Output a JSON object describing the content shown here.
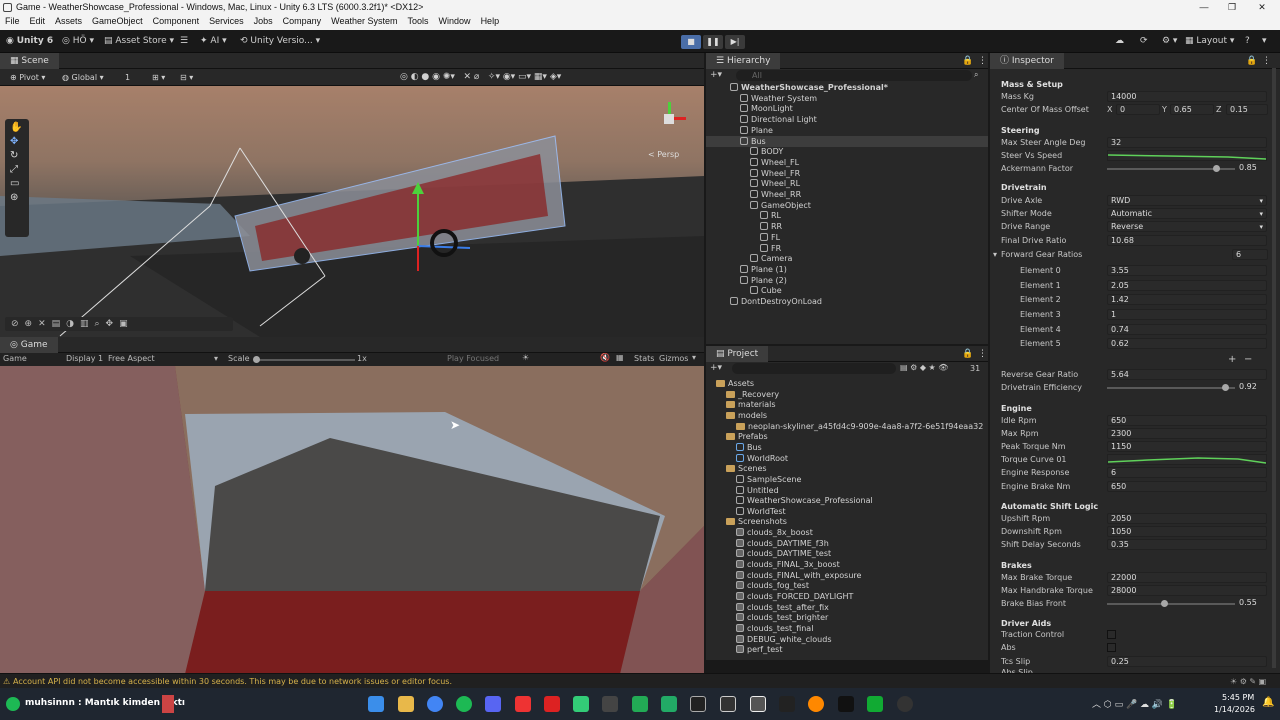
{
  "window": {
    "title": "Game - WeatherShowcase_Professional - Windows, Mac, Linux - Unity 6.3 LTS (6000.3.2f1)* <DX12>"
  },
  "menu": [
    "File",
    "Edit",
    "Assets",
    "GameObject",
    "Component",
    "Services",
    "Jobs",
    "Company",
    "Weather System",
    "Tools",
    "Window",
    "Help"
  ],
  "toolbar": {
    "unity": "Unity 6",
    "account": "HÖ",
    "asset_store": "Asset Store",
    "ai": "AI",
    "version": "Unity Versio...",
    "layout": "Layout"
  },
  "scene": {
    "tab": "Scene",
    "pivot": "Pivot",
    "global": "Global",
    "grid_snap": "1",
    "persp": "< Persp"
  },
  "game": {
    "tab": "Game",
    "game_label": "Game",
    "display": "Display 1",
    "aspect": "Free Aspect",
    "scale_label": "Scale",
    "scale_value": "1x",
    "play_focused": "Play Focused",
    "stats": "Stats",
    "gizmos": "Gizmos"
  },
  "hierarchy": {
    "tab": "Hierarchy",
    "search": "All",
    "items": [
      {
        "label": "WeatherShowcase_Professional*",
        "depth": 0,
        "bold": true
      },
      {
        "label": "Weather System",
        "depth": 1
      },
      {
        "label": "MoonLight",
        "depth": 1
      },
      {
        "label": "Directional Light",
        "depth": 1
      },
      {
        "label": "Plane",
        "depth": 1
      },
      {
        "label": "Bus",
        "depth": 1,
        "selected": true
      },
      {
        "label": "BODY",
        "depth": 2
      },
      {
        "label": "Wheel_FL",
        "depth": 2
      },
      {
        "label": "Wheel_FR",
        "depth": 2
      },
      {
        "label": "Wheel_RL",
        "depth": 2
      },
      {
        "label": "Wheel_RR",
        "depth": 2
      },
      {
        "label": "GameObject",
        "depth": 2
      },
      {
        "label": "RL",
        "depth": 3
      },
      {
        "label": "RR",
        "depth": 3
      },
      {
        "label": "FL",
        "depth": 3
      },
      {
        "label": "FR",
        "depth": 3
      },
      {
        "label": "Camera",
        "depth": 2
      },
      {
        "label": "Plane (1)",
        "depth": 1
      },
      {
        "label": "Plane (2)",
        "depth": 1
      },
      {
        "label": "Cube",
        "depth": 2
      },
      {
        "label": "DontDestroyOnLoad",
        "depth": 0
      }
    ]
  },
  "project": {
    "tab": "Project",
    "count": "31",
    "items": [
      {
        "label": "Assets",
        "depth": 0,
        "type": "folder"
      },
      {
        "label": "_Recovery",
        "depth": 1,
        "type": "folder"
      },
      {
        "label": "materials",
        "depth": 1,
        "type": "folder"
      },
      {
        "label": "models",
        "depth": 1,
        "type": "folder"
      },
      {
        "label": "neoplan-skyliner_a45fd4c9-909e-4aa8-a7f2-6e51f94eaa32",
        "depth": 2,
        "type": "folder"
      },
      {
        "label": "Prefabs",
        "depth": 1,
        "type": "folder"
      },
      {
        "label": "Bus",
        "depth": 2,
        "type": "prefab"
      },
      {
        "label": "WorldRoot",
        "depth": 2,
        "type": "prefab"
      },
      {
        "label": "Scenes",
        "depth": 1,
        "type": "folder"
      },
      {
        "label": "SampleScene",
        "depth": 2,
        "type": "scene"
      },
      {
        "label": "Untitled",
        "depth": 2,
        "type": "scene"
      },
      {
        "label": "WeatherShowcase_Professional",
        "depth": 2,
        "type": "scene"
      },
      {
        "label": "WorldTest",
        "depth": 2,
        "type": "scene"
      },
      {
        "label": "Screenshots",
        "depth": 1,
        "type": "folder"
      },
      {
        "label": "clouds_8x_boost",
        "depth": 2,
        "type": "img"
      },
      {
        "label": "clouds_DAYTIME_f3h",
        "depth": 2,
        "type": "img"
      },
      {
        "label": "clouds_DAYTIME_test",
        "depth": 2,
        "type": "img"
      },
      {
        "label": "clouds_FINAL_3x_boost",
        "depth": 2,
        "type": "img"
      },
      {
        "label": "clouds_FINAL_with_exposure",
        "depth": 2,
        "type": "img"
      },
      {
        "label": "clouds_fog_test",
        "depth": 2,
        "type": "img"
      },
      {
        "label": "clouds_FORCED_DAYLIGHT",
        "depth": 2,
        "type": "img"
      },
      {
        "label": "clouds_test_after_fix",
        "depth": 2,
        "type": "img"
      },
      {
        "label": "clouds_test_brighter",
        "depth": 2,
        "type": "img"
      },
      {
        "label": "clouds_test_final",
        "depth": 2,
        "type": "img"
      },
      {
        "label": "DEBUG_white_clouds",
        "depth": 2,
        "type": "img"
      },
      {
        "label": "perf_test",
        "depth": 2,
        "type": "img"
      }
    ]
  },
  "inspector": {
    "tab": "Inspector",
    "mass_setup": {
      "header": "Mass & Setup",
      "mass_label": "Mass Kg",
      "mass": "14000",
      "com_label": "Center Of Mass Offset",
      "x": "0",
      "y": "0.65",
      "z": "0.15"
    },
    "steering": {
      "header": "Steering",
      "max_label": "Max Steer Angle Deg",
      "max": "32",
      "svs_label": "Steer Vs Speed",
      "ack_label": "Ackermann Factor",
      "ack": "0.85",
      "ack_frac": 0.85
    },
    "drivetrain": {
      "header": "Drivetrain",
      "axle_label": "Drive Axle",
      "axle": "RWD",
      "shifter_label": "Shifter Mode",
      "shifter": "Automatic",
      "range_label": "Drive Range",
      "range": "Reverse",
      "final_label": "Final Drive Ratio",
      "final": "10.68",
      "fgr_label": "Forward Gear Ratios",
      "fgr_count": "6",
      "elements": [
        {
          "label": "Element 0",
          "value": "3.55"
        },
        {
          "label": "Element 1",
          "value": "2.05"
        },
        {
          "label": "Element 2",
          "value": "1.42"
        },
        {
          "label": "Element 3",
          "value": "1"
        },
        {
          "label": "Element 4",
          "value": "0.74"
        },
        {
          "label": "Element 5",
          "value": "0.62"
        }
      ],
      "rev_label": "Reverse Gear Ratio",
      "rev": "5.64",
      "eff_label": "Drivetrain Efficiency",
      "eff": "0.92",
      "eff_frac": 0.92
    },
    "engine": {
      "header": "Engine",
      "idle_label": "Idle Rpm",
      "idle": "650",
      "max_label": "Max Rpm",
      "max": "2300",
      "peak_label": "Peak Torque Nm",
      "peak": "1150",
      "curve_label": "Torque Curve 01",
      "resp_label": "Engine Response",
      "resp": "6",
      "brake_label": "Engine Brake Nm",
      "brake": "650"
    },
    "shift": {
      "header": "Automatic Shift Logic",
      "up_label": "Upshift Rpm",
      "up": "2050",
      "down_label": "Downshift Rpm",
      "down": "1050",
      "delay_label": "Shift Delay Seconds",
      "delay": "0.35"
    },
    "brakes": {
      "header": "Brakes",
      "maxb_label": "Max Brake Torque",
      "maxb": "22000",
      "hb_label": "Max Handbrake Torque",
      "hb": "28000",
      "bias_label": "Brake Bias Front",
      "bias": "0.55",
      "bias_frac": 0.55
    },
    "aids": {
      "header": "Driver Aids",
      "tc_label": "Traction Control",
      "abs_label": "Abs",
      "tcs_label": "Tcs Slip",
      "tcs": "0.25",
      "abs_slip": "Abs Slip"
    }
  },
  "status": {
    "message": "Account API did not become accessible within 30 seconds. This may be due to network issues or editor focus."
  },
  "taskbar": {
    "user": "muhsinnn : Mantık kimden çıktı",
    "time": "5:45 PM",
    "date": "1/14/2026"
  }
}
